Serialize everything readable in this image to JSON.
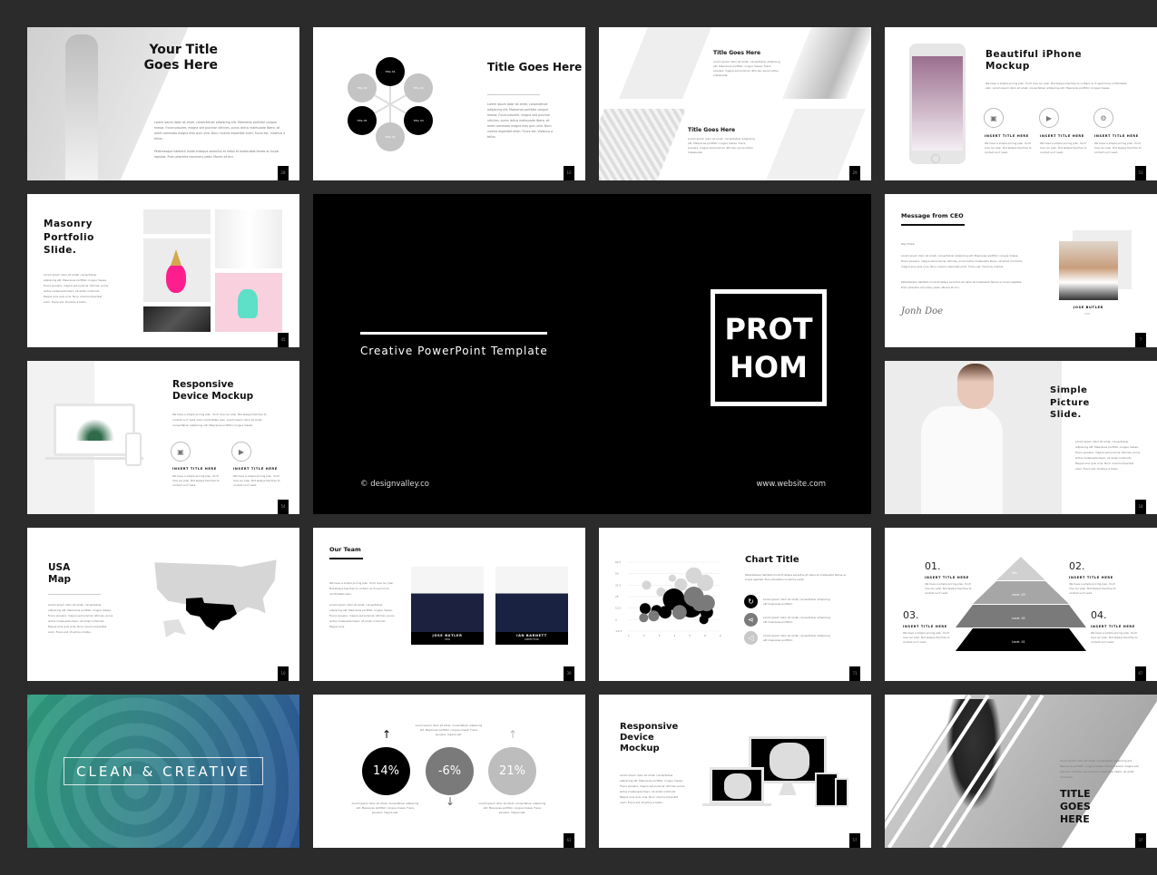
{
  "background_color": "#2b2b2b",
  "slides": [
    {
      "title": "Your Title Goes Here",
      "body": [
        "Lorem ipsum dolor sit amet, consectetuer adipiscing elit. Maecenas porttitor congue massa. Fusce posuere, magna sed pulvinar ultricies, purus lectus malesuada libero, sit amet commodo magna eros quis urna. Nunc viverra imperdiet enim. Fusce est. Vivamus a tellus.",
        "Pellentesque habitant morbi tristique senectus et netus et malesuada fames ac turpis egestas. Proin pharetra nonummy pede. Mauris et orci."
      ],
      "page": "28"
    },
    {
      "title": "Title Goes Here",
      "body": "Lorem ipsum dolor sit amet, consectetuer adipiscing elit. Maecenas porttitor congue massa. Fusce posuere, magna sed pulvinar ultricies, purus lectus malesuada libero, sit amet commodo magna eros quis urna. Nunc viverra imperdiet enim. Fusce est. Vivamus a tellus.",
      "circles": [
        {
          "label": "Title 01",
          "tone": "dark"
        },
        {
          "label": "Title 02",
          "tone": "light"
        },
        {
          "label": "Title 03",
          "tone": "dark"
        },
        {
          "label": "Title 04",
          "tone": "light"
        },
        {
          "label": "Title 05",
          "tone": "dark"
        },
        {
          "label": "Title 06",
          "tone": "light"
        }
      ],
      "page": "10"
    },
    {
      "blocks": [
        {
          "title": "Title Goes Here",
          "body": "Lorem ipsum dolor sit amet, consectetuer adipiscing elit. Maecenas porttitor congue massa. Fusce posuere, magna sed pulvinar ultricies, purus lectus malesuada."
        },
        {
          "title": "Title Goes Here",
          "body": "Lorem ipsum dolor sit amet, consectetuer adipiscing elit. Maecenas porttitor congue massa. Fusce posuere, magna sed pulvinar ultricies, purus lectus malesuada."
        }
      ],
      "page": "29"
    },
    {
      "title": "Beautiful iPhone Mockup",
      "body": "We have a simple pricing plan. You'll love our plan. But always feel free to contact us if need more comfortable plan. Lorem ipsum dolor sit amet, consectetuer adipiscing elit. Maecenas porttitor congue massa.",
      "features": [
        {
          "icon": "image-icon",
          "glyph": "▣",
          "title": "INSERT TITLE HERE",
          "body": "We have a simple pricing plan. You'll love our plan. But always feel free to contact us if need."
        },
        {
          "icon": "video-icon",
          "glyph": "▶",
          "title": "INSERT TITLE HERE",
          "body": "We have a simple pricing plan. You'll love our plan. But always feel free to contact us if need."
        },
        {
          "icon": "gear-icon",
          "glyph": "⚙",
          "title": "INSERT TITLE HERE",
          "body": "We have a simple pricing plan. You'll love our plan. But always feel free to contact us if need."
        }
      ],
      "page": "53"
    },
    {
      "title": "Masonry Portfolio Slide.",
      "body": "Lorem ipsum dolor sit amet, consectetuer adipiscing elit. Maecenas porttitor congue massa. Fusce posuere, magna sed pulvinar ultricies, purus lectus malesuada libero, sit amet commodo. Magna eros quis urna. Nunc viverra imperdiet enim. Fusce est. Vivamus a tellus.",
      "page": "45"
    },
    {
      "tagline": "Creative PowerPoint Template",
      "logo_line1": "PROT",
      "logo_line2": "HOM",
      "copyright": "© designvalley.co",
      "website": "www.website.com"
    },
    {
      "title": "Message from CEO",
      "greeting": "Hey Folks,",
      "body": [
        "Lorem ipsum dolor sit amet, consectetuer adipiscing elit. Maecenas porttitor congue massa. Fusce posuere, magna sed pulvinar ultricies, purus lectus malesuada libero, sit amet commodo magna eros quis urna. Nunc viverra imperdiet enim. Fusce est. Vivamus a tellus.",
        "Pellentesque habitant morbi tristique senectus et netus et malesuada fames ac turpis egestas. Proin pharetra nonummy pede. Mauris et orci."
      ],
      "signature": "Jonh Doe",
      "person_name": "JOSE BUTLER",
      "person_role": "CEO",
      "page": "7"
    },
    {
      "title": "Responsive Device Mockup",
      "body": "We have a simple pricing plan. You'll love our plan. But always feel free to contact us if need more comfortable plan. Lorem ipsum dolor sit amet, consectetuer adipiscing elit. Maecenas porttitor congue massa.",
      "features": [
        {
          "icon": "image-icon",
          "glyph": "▣",
          "title": "INSERT TITLE HERE",
          "body": "We have a simple pricing plan. You'll love our plan. But always feel free to contact us if need."
        },
        {
          "icon": "video-icon",
          "glyph": "▶",
          "title": "INSERT TITLE HERE",
          "body": "We have a simple pricing plan. You'll love our plan. But always feel free to contact us if need."
        }
      ],
      "page": "54"
    },
    {
      "title": "Simple Picture Slide.",
      "body": "Lorem ipsum dolor sit amet, consectetuer adipiscing elit. Maecenas porttitor congue massa. Fusce posuere, magna sed pulvinar ultricies, purus lectus malesuada libero, sit amet commodo. Magna eros quis urna. Nunc viverra imperdiet enim. Fusce est. Vivamus a tellus.",
      "page": "18"
    },
    {
      "title": "USA Map",
      "body": "Lorem ipsum dolor sit amet, consectetuer adipiscing elit. Maecenas porttitor congue massa. Fusce posuere, magna sed pulvinar ultricies, purus lectus malesuada libero, sit amet commodo. Magna eros quis urna. Nunc viverra imperdiet enim. Fusce est. Vivamus a tellus.",
      "page": "10"
    },
    {
      "title": "Our Team",
      "body": [
        "We have a simple pricing plan. You'll love our plan. But always feel free to contact us if need more comfortable plan.",
        "Lorem ipsum dolor sit amet, consectetuer adipiscing elit. Maecenas porttitor congue massa. Fusce posuere, magna sed pulvinar ultricies, purus lectus malesuada libero, sit amet commodo. Magna eros."
      ],
      "members": [
        {
          "name": "JOSE BUTLER",
          "role": "CEO"
        },
        {
          "name": "IAN BARNETT",
          "role": "DIRECTOR"
        }
      ],
      "page": "39"
    },
    {
      "title": "Chart Title",
      "body": "Pellentesque habitant morbi tristique senectus et netus et malesuada fames ac turpis egestas. Proin pharetra nonummy pede.",
      "items": [
        {
          "icon": "refresh-icon",
          "glyph": "↻",
          "text": "Lorem ipsum dolor sit amet, consectetuer adipiscing elit maecenas porttitor."
        },
        {
          "icon": "share-icon",
          "glyph": "⋖",
          "text": "Lorem ipsum dolor sit amet, consectetuer adipiscing elit maecenas porttitor."
        },
        {
          "icon": "megaphone-icon",
          "glyph": "◁",
          "text": "Lorem ipsum dolor sit amet, consectetuer adipiscing elit maecenas porttitor."
        }
      ],
      "page": "71"
    },
    {
      "steps": [
        {
          "num": "01.",
          "title": "INSERT TITLE HERE",
          "body": "We have a simple pricing plan. You'll love our plan. But always feel free to contact us if need."
        },
        {
          "num": "02.",
          "title": "INSERT TITLE HERE",
          "body": "We have a simple pricing plan. You'll love our plan. But always feel free to contact us if need."
        },
        {
          "num": "03.",
          "title": "INSERT TITLE HERE",
          "body": "We have a simple pricing plan. You'll love our plan. But always feel free to contact us if need."
        },
        {
          "num": "04.",
          "title": "INSERT TITLE HERE",
          "body": "We have a simple pricing plan. You'll love our plan. But always feel free to contact us if need."
        }
      ],
      "levels": [
        "Win",
        "Level -03",
        "Level -02",
        "Level -01"
      ],
      "page": "67"
    },
    {
      "title": "CLEAN & CREATIVE"
    },
    {
      "stats": [
        {
          "value": "14%",
          "direction": "up",
          "tone": "#000000"
        },
        {
          "value": "-6%",
          "direction": "down",
          "tone": "#7a7a7a"
        },
        {
          "value": "21%",
          "direction": "up",
          "tone": "#bdbdbd"
        }
      ],
      "texts": [
        "Lorem ipsum dolor sit amet, consectetuer adipiscing elit. Maecenas porttitor congue massa. Fusce posuere, magna sed.",
        "Lorem ipsum dolor sit amet, consectetuer adipiscing elit. Maecenas porttitor congue massa. Fusce posuere, magna sed.",
        "Lorem ipsum dolor sit amet, consectetuer adipiscing elit. Maecenas porttitor congue massa. Fusce posuere, magna sed."
      ],
      "page": "63"
    },
    {
      "title": "Responsive Device Mockup",
      "body": "Lorem ipsum dolor sit amet, consectetuer adipiscing elit. Maecenas porttitor congue massa. Fusce posuere, magna sed pulvinar ultricies, purus lectus malesuada libero, sit amet commodo. Magna eros quis urna. Nunc viverra imperdiet enim. Fusce est. Vivamus a tellus.",
      "page": "57"
    },
    {
      "title": "TITLE GOES HERE",
      "body": "Lorem ipsum dolor sit amet, consectetuer adipiscing elit. Maecenas porttitor congue massa. Fusce posuere, magna sed pulvinar ultricies, purus lectus malesuada. libero, sit amet commodo.",
      "page": "37"
    }
  ],
  "bubble_chart": {
    "type": "scatter",
    "yticks": [
      "62.5",
      "50",
      "37.5",
      "25",
      "12.5",
      "0",
      "-12.5"
    ],
    "xticks": [
      "1",
      "2",
      "3",
      "4",
      "5",
      "6",
      "6"
    ],
    "series": [
      {
        "name": "light",
        "color": "#d6d6d6",
        "points": [
          [
            1.5,
            37.5,
            5
          ],
          [
            3.3,
            45,
            4
          ],
          [
            4.8,
            48,
            9
          ],
          [
            5.6,
            40,
            9
          ],
          [
            3.9,
            38,
            7
          ],
          [
            2.5,
            30,
            5
          ]
        ]
      },
      {
        "name": "black",
        "color": "#000000",
        "points": [
          [
            1.4,
            12,
            6
          ],
          [
            2.2,
            10,
            6
          ],
          [
            3.4,
            22,
            12
          ],
          [
            4.6,
            15,
            13
          ],
          [
            5.7,
            8,
            7
          ],
          [
            5.5,
            0,
            5
          ],
          [
            2.8,
            8,
            7
          ]
        ]
      },
      {
        "name": "gray",
        "color": "#7a7a7a",
        "points": [
          [
            1.3,
            2,
            5
          ],
          [
            2,
            4,
            6
          ],
          [
            3.8,
            8,
            8
          ],
          [
            4.8,
            25,
            11
          ],
          [
            5.2,
            17,
            8
          ],
          [
            5.7,
            18,
            9
          ],
          [
            4.6,
            28,
            6
          ]
        ]
      }
    ]
  }
}
